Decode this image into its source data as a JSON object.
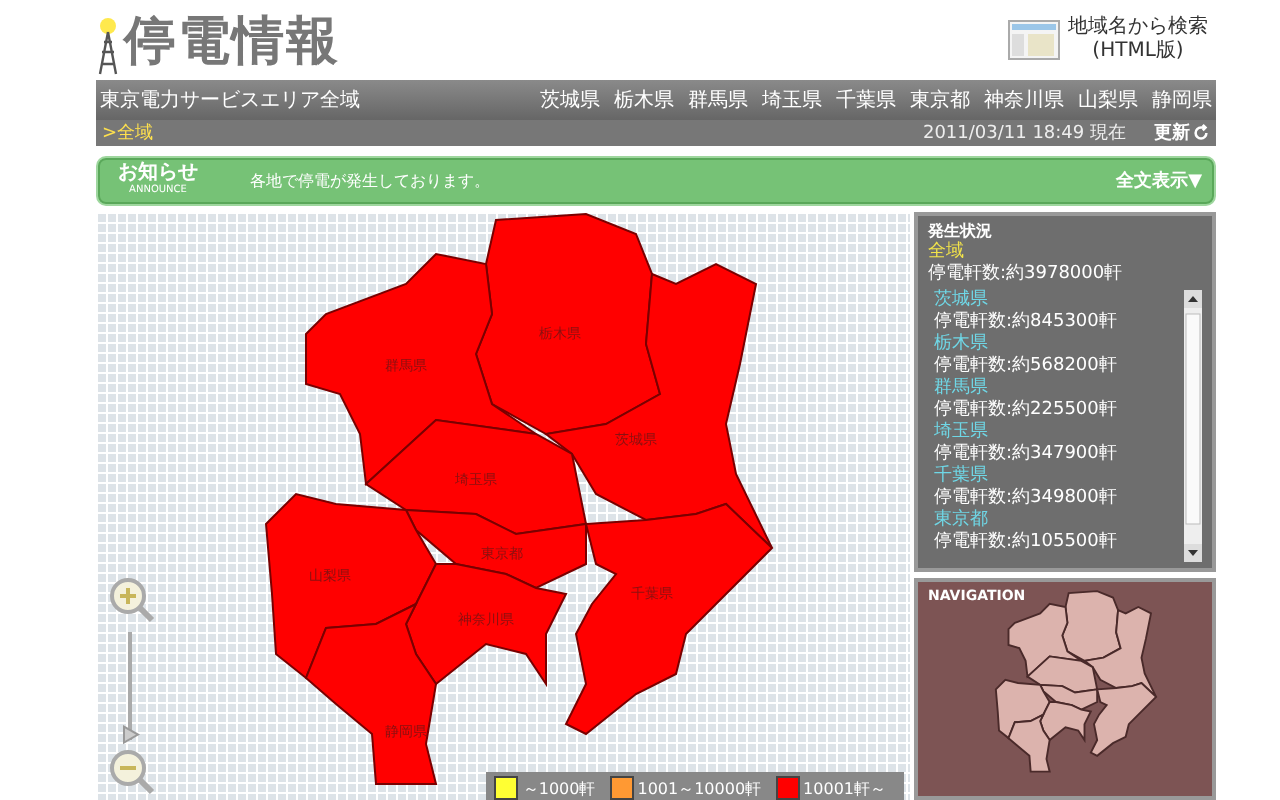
{
  "header": {
    "title": "停電情報",
    "search_link": [
      "地域名から検索",
      "(HTML版)"
    ]
  },
  "nav": {
    "area": "東京電力サービスエリア全域",
    "prefectures": [
      "茨城県",
      "栃木県",
      "群馬県",
      "埼玉県",
      "千葉県",
      "東京都",
      "神奈川県",
      "山梨県",
      "静岡県"
    ]
  },
  "subbar": {
    "breadcrumb": ">全域",
    "timestamp": "2011/03/11 18:49 現在",
    "refresh": "更新"
  },
  "announce": {
    "title": "お知らせ",
    "subtitle": "ANNOUNCE",
    "message": "各地で停電が発生しております。",
    "expand": "全文表示▼"
  },
  "map": {
    "prefectures": [
      {
        "name": "栃木県",
        "color": "#ff0000"
      },
      {
        "name": "群馬県",
        "color": "#ff0000"
      },
      {
        "name": "茨城県",
        "color": "#ff0000"
      },
      {
        "name": "埼玉県",
        "color": "#ff0000"
      },
      {
        "name": "東京都",
        "color": "#ff0000"
      },
      {
        "name": "千葉県",
        "color": "#ff0000"
      },
      {
        "name": "山梨県",
        "color": "#ff0000"
      },
      {
        "name": "神奈川県",
        "color": "#ff0000"
      },
      {
        "name": "静岡県",
        "color": "#ff0000"
      }
    ],
    "legend": [
      {
        "label": "～1000軒",
        "color": "#ffff33"
      },
      {
        "label": "1001～10000軒",
        "color": "#ff9933"
      },
      {
        "label": "10001軒～",
        "color": "#ff0000"
      }
    ]
  },
  "status": {
    "title": "発生状況",
    "area": "全域",
    "total": "停電軒数:約3978000軒",
    "items": [
      {
        "name": "茨城県",
        "count": "停電軒数:約845300軒"
      },
      {
        "name": "栃木県",
        "count": "停電軒数:約568200軒"
      },
      {
        "name": "群馬県",
        "count": "停電軒数:約225500軒"
      },
      {
        "name": "埼玉県",
        "count": "停電軒数:約347900軒"
      },
      {
        "name": "千葉県",
        "count": "停電軒数:約349800軒"
      },
      {
        "name": "東京都",
        "count": "停電軒数:約105500軒"
      }
    ]
  },
  "navigation": {
    "title": "NAVIGATION"
  },
  "zoom": {
    "level": 0.05
  }
}
